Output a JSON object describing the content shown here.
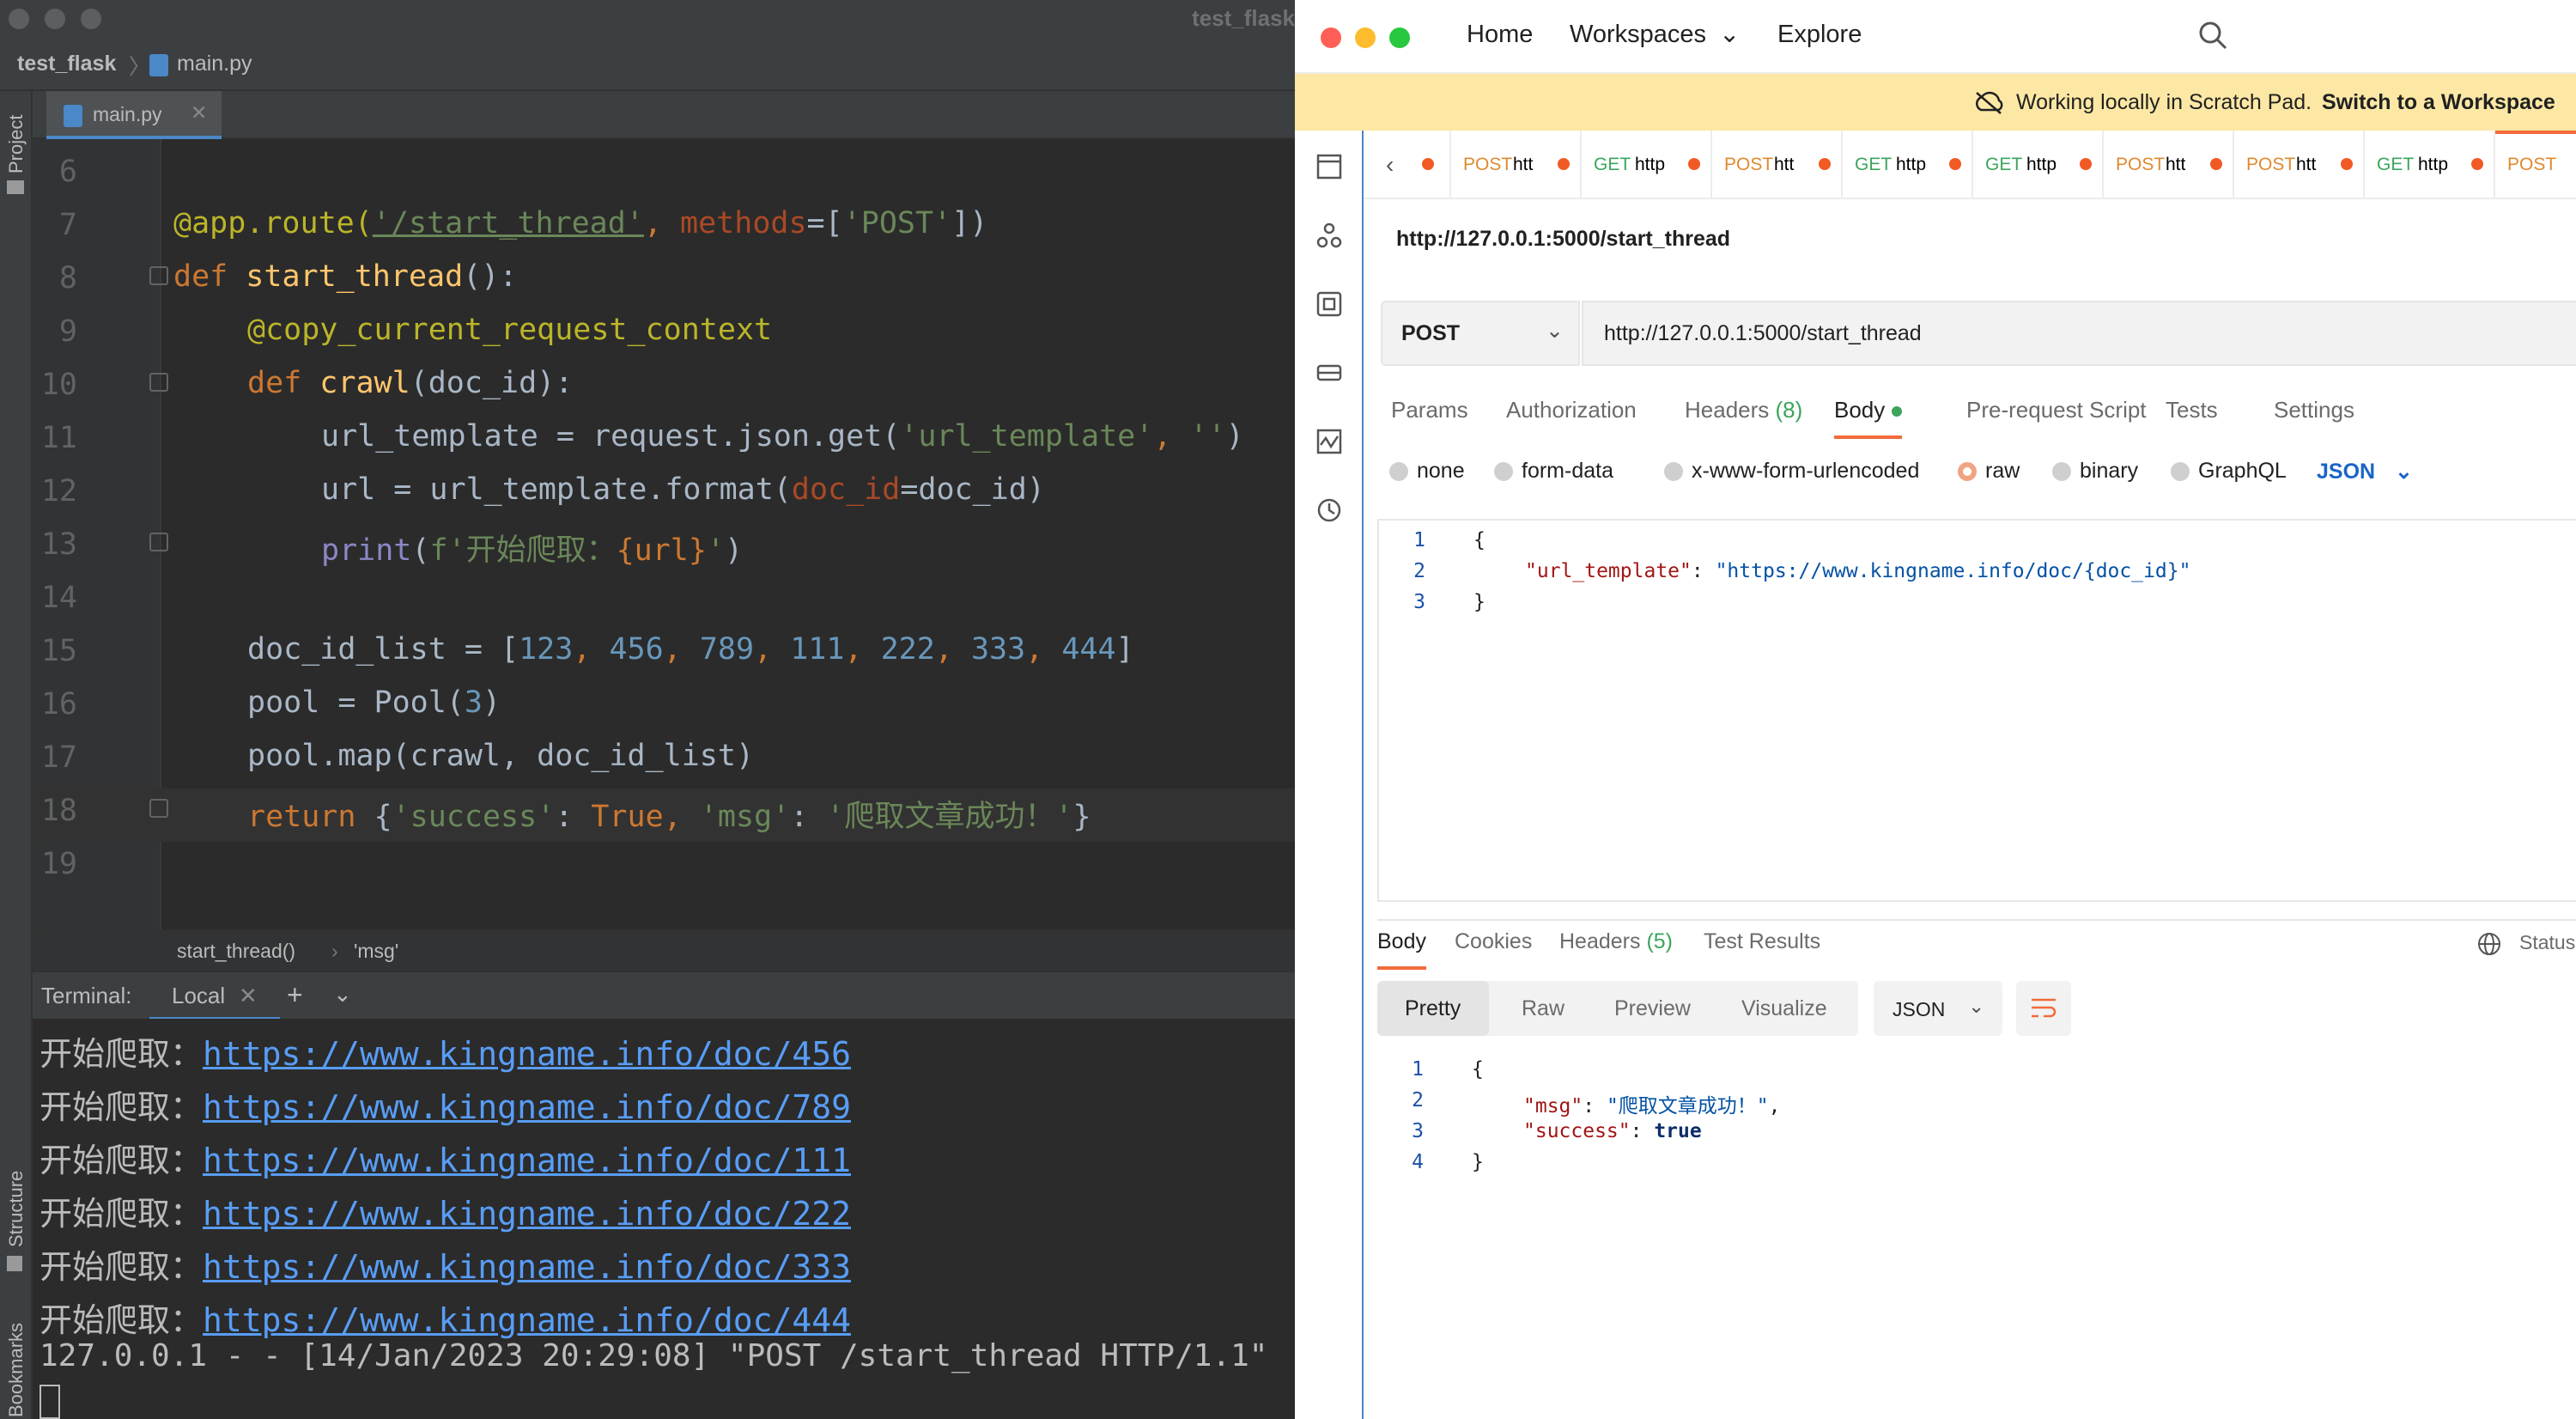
{
  "ide": {
    "window_title": "test_flask",
    "breadcrumb_project": "test_flask",
    "breadcrumb_file": "main.py",
    "tab_label": "main.py",
    "side_project": "Project",
    "side_structure": "Structure",
    "side_bookmarks": "Bookmarks",
    "line_numbers": [
      "6",
      "7",
      "8",
      "9",
      "10",
      "11",
      "12",
      "13",
      "14",
      "15",
      "16",
      "17",
      "18",
      "19"
    ],
    "code": {
      "l7a": "@app.route(",
      "l7b": "'/start_thread'",
      "l7c": ", ",
      "l7d": "methods",
      "l7e": "=[",
      "l7f": "'POST'",
      "l7g": "])",
      "l8a": "def ",
      "l8b": "start_thread",
      "l8c": "():",
      "l9": "@copy_current_request_context",
      "l10a": "def ",
      "l10b": "crawl",
      "l10c": "(doc_id):",
      "l11a": "url_template = request.json.get(",
      "l11b": "'url_template'",
      "l11c": ", ",
      "l11d": "''",
      "l11e": ")",
      "l12a": "url = url_template.format(",
      "l12b": "doc_id",
      "l12c": "=doc_id)",
      "l13a": "print",
      "l13b": "(",
      "l13c": "f'开始爬取：",
      "l13d": "{url}",
      "l13e": "'",
      "l13f": ")",
      "l15a": "doc_id_list = [",
      "l15_nums": [
        "123",
        "456",
        "789",
        "111",
        "222",
        "333",
        "444"
      ],
      "l15_sep": ", ",
      "l15z": "]",
      "l16a": "pool = Pool(",
      "l16b": "3",
      "l16c": ")",
      "l17": "pool.map(crawl, doc_id_list)",
      "l18a": "return ",
      "l18b": "{",
      "l18c": "'success'",
      "l18d": ": ",
      "l18e": "True",
      "l18f": ", ",
      "l18g": "'msg'",
      "l18h": ": ",
      "l18i": "'爬取文章成功！'",
      "l18j": "}"
    },
    "code_breadcrumb_fn": "start_thread()",
    "code_breadcrumb_sep": "›",
    "code_breadcrumb_key": "'msg'",
    "terminal_label": "Terminal:",
    "terminal_tab": "Local",
    "terminal_prefix": "开始爬取：",
    "terminal_links": [
      "https://www.kingname.info/doc/456",
      "https://www.kingname.info/doc/789",
      "https://www.kingname.info/doc/111",
      "https://www.kingname.info/doc/222",
      "https://www.kingname.info/doc/333",
      "https://www.kingname.info/doc/444"
    ],
    "terminal_log": "127.0.0.1 - - [14/Jan/2023 20:29:08] \"POST /start_thread HTTP/1.1\""
  },
  "postman": {
    "nav": [
      "Home",
      "Workspaces",
      "Explore"
    ],
    "banner_text": "Working locally in Scratch Pad.",
    "banner_link": "Switch to a Workspace",
    "request_tabs": [
      {
        "method": "POST",
        "name": "htt"
      },
      {
        "method": "GET",
        "name": "http"
      },
      {
        "method": "POST",
        "name": "htt"
      },
      {
        "method": "GET",
        "name": "http"
      },
      {
        "method": "GET",
        "name": "http"
      },
      {
        "method": "POST",
        "name": "htt"
      },
      {
        "method": "POST",
        "name": "htt"
      },
      {
        "method": "GET",
        "name": "http"
      },
      {
        "method": "POST",
        "name": ""
      }
    ],
    "request_name": "http://127.0.0.1:5000/start_thread",
    "method": "POST",
    "url": "http://127.0.0.1:5000/start_thread",
    "req_tabs": {
      "params": "Params",
      "authorization": "Authorization",
      "headers": "Headers",
      "headers_count": "(8)",
      "body": "Body",
      "prerequest": "Pre-request Script",
      "tests": "Tests",
      "settings": "Settings"
    },
    "body_options": [
      "none",
      "form-data",
      "x-www-form-urlencoded",
      "raw",
      "binary",
      "GraphQL"
    ],
    "body_format": "JSON",
    "request_body_lines": [
      "1",
      "2",
      "3"
    ],
    "request_body": {
      "open": "{",
      "key": "\"url_template\"",
      "colon": ": ",
      "value": "\"https://www.kingname.info/doc/{doc_id}\"",
      "close": "}"
    },
    "res_tabs": {
      "body": "Body",
      "cookies": "Cookies",
      "headers": "Headers",
      "headers_count": "(5)",
      "test_results": "Test Results",
      "status": "Status"
    },
    "res_modes": [
      "Pretty",
      "Raw",
      "Preview",
      "Visualize"
    ],
    "res_format": "JSON",
    "response_lines": [
      "1",
      "2",
      "3",
      "4"
    ],
    "response": {
      "open": "{",
      "msg_key": "\"msg\"",
      "msg_val": "\"爬取文章成功！\"",
      "success_key": "\"success\"",
      "success_val": "true",
      "comma": ",",
      "colon": ": ",
      "close": "}"
    }
  }
}
